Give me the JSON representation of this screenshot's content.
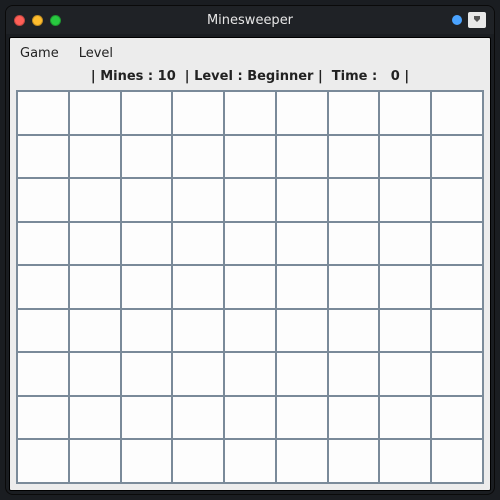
{
  "window": {
    "title": "Minesweeper"
  },
  "menubar": {
    "game": "Game",
    "level": "Level"
  },
  "status": {
    "mines_label": "Mines",
    "mines_value": 10,
    "level_label": "Level",
    "level_value": "Beginner",
    "time_label": "Time",
    "time_value": 0
  },
  "grid": {
    "rows": 9,
    "cols": 9
  }
}
